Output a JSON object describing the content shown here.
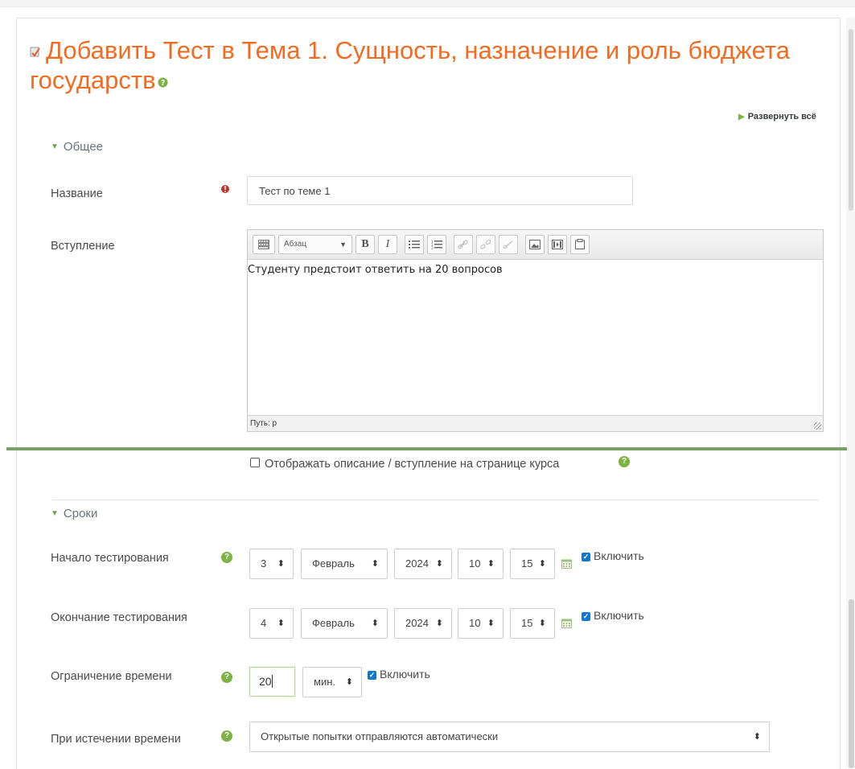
{
  "title": "Добавить Тест в Тема 1. Сущность, назначение и роль бюджета государств",
  "expand_all": "Развернуть всё",
  "general": {
    "heading": "Общее",
    "name_label": "Название",
    "name_value": "Тест по теме 1",
    "intro_label": "Вступление",
    "editor": {
      "format_select": "Абзац",
      "body_text": "Студенту предстоит ответить на 20 вопросов",
      "path": "Путь: p",
      "toolbar_icons": [
        "toolbar-toggle-icon",
        "bold-icon",
        "italic-icon",
        "unordered-list-icon",
        "ordered-list-icon",
        "link-icon",
        "unlink-icon",
        "anchor-icon",
        "image-icon",
        "media-icon",
        "paste-icon"
      ]
    },
    "show_description_label": "Отображать описание / вступление на странице курса"
  },
  "timing": {
    "heading": "Сроки",
    "open": {
      "label": "Начало тестирования",
      "day": "3",
      "month": "Февраль",
      "year": "2024",
      "hour": "10",
      "minute": "15",
      "enable_label": "Включить",
      "enabled": true
    },
    "close": {
      "label": "Окончание тестирования",
      "day": "4",
      "month": "Февраль",
      "year": "2024",
      "hour": "10",
      "minute": "15",
      "enable_label": "Включить",
      "enabled": true
    },
    "time_limit": {
      "label": "Ограничение времени",
      "value": "20",
      "unit": "мин.",
      "enable_label": "Включить",
      "enabled": true
    },
    "when_expires": {
      "label": "При истечении времени",
      "value": "Открытые попытки отправляются автоматически"
    }
  },
  "colors": {
    "title": "#f26b21",
    "accent_green": "#7cb342",
    "required_red": "#c9302c",
    "checkbox_blue": "#1177d1"
  }
}
